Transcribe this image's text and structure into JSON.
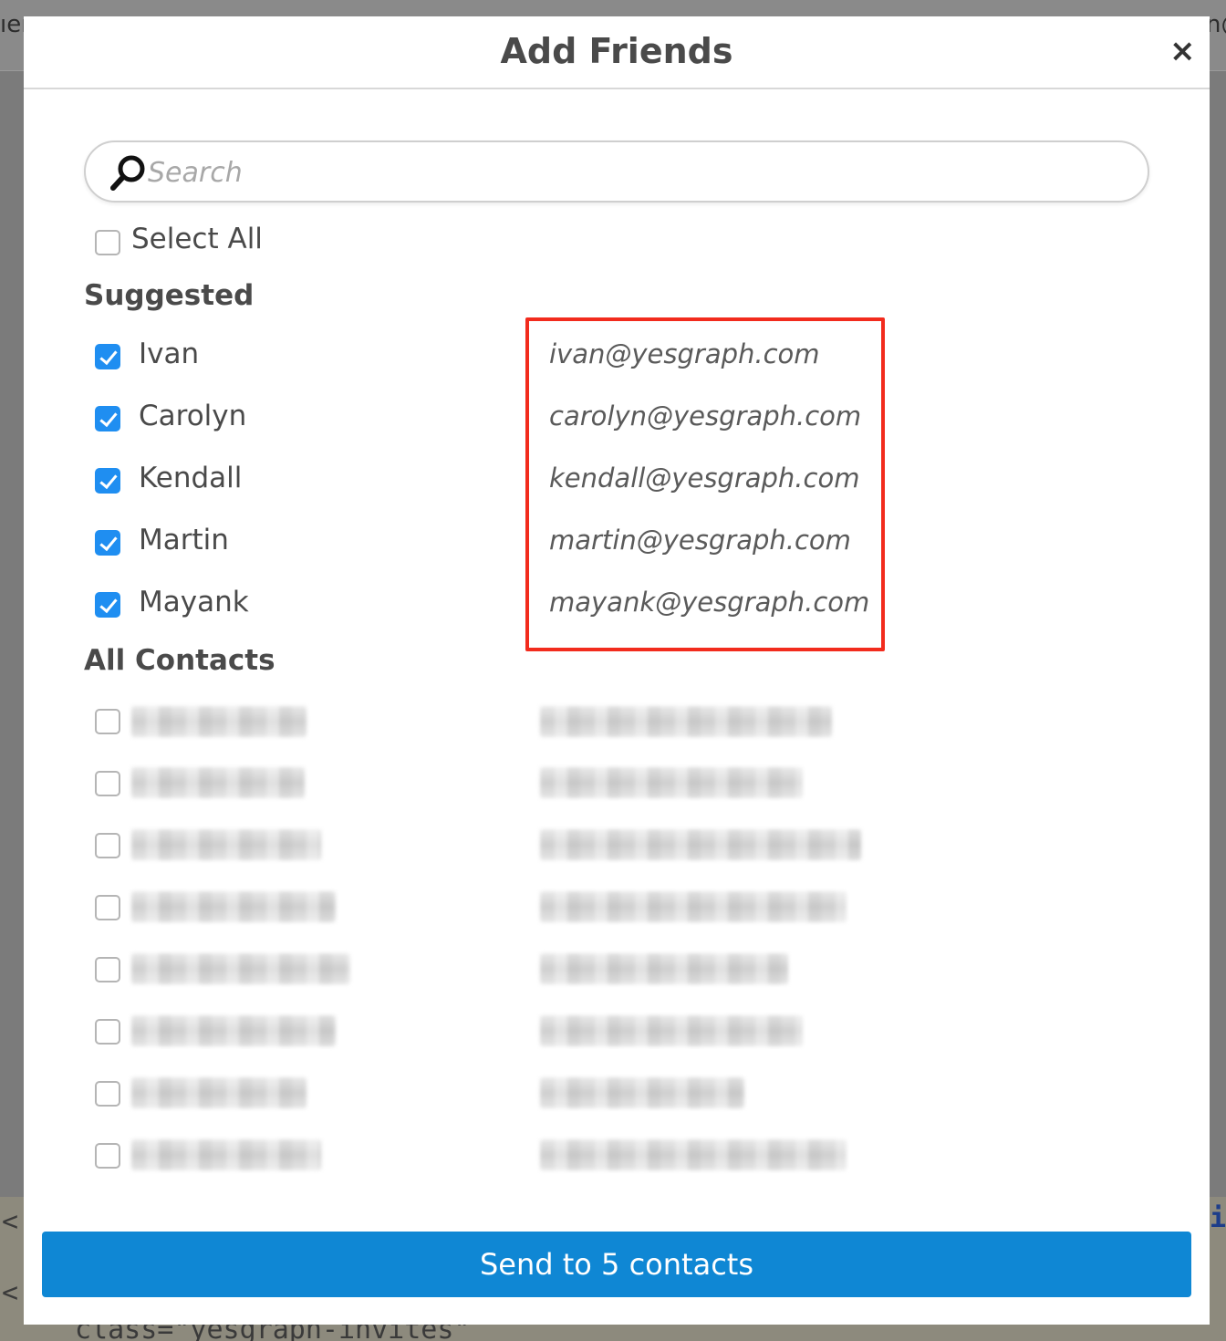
{
  "modal": {
    "title": "Add Friends",
    "close_label": "×"
  },
  "search": {
    "placeholder": "Search",
    "value": ""
  },
  "select_all": {
    "label": "Select All",
    "checked": false
  },
  "suggested": {
    "heading": "Suggested",
    "contacts": [
      {
        "name": "Ivan",
        "email": "ivan@yesgraph.com",
        "checked": true
      },
      {
        "name": "Carolyn",
        "email": "carolyn@yesgraph.com",
        "checked": true
      },
      {
        "name": "Kendall",
        "email": "kendall@yesgraph.com",
        "checked": true
      },
      {
        "name": "Martin",
        "email": "martin@yesgraph.com",
        "checked": true
      },
      {
        "name": "Mayank",
        "email": "mayank@yesgraph.com",
        "checked": true
      }
    ]
  },
  "all_contacts": {
    "heading": "All Contacts",
    "rows_checked": [
      false,
      false,
      false,
      false,
      false,
      false,
      false,
      false
    ]
  },
  "send_button": {
    "label": "Send to 5 contacts"
  },
  "colors": {
    "accent": "#1f8ef1",
    "button": "#0f87d4",
    "highlight": "#f22b1d"
  },
  "backdrop": {
    "top_left_fragment": "ıer",
    "top_right_fragment": "n@",
    "code_left_1": "<",
    "code_left_2": "<",
    "code_right": "i",
    "code_bottom": "class=\"yesgraph-invites\""
  }
}
